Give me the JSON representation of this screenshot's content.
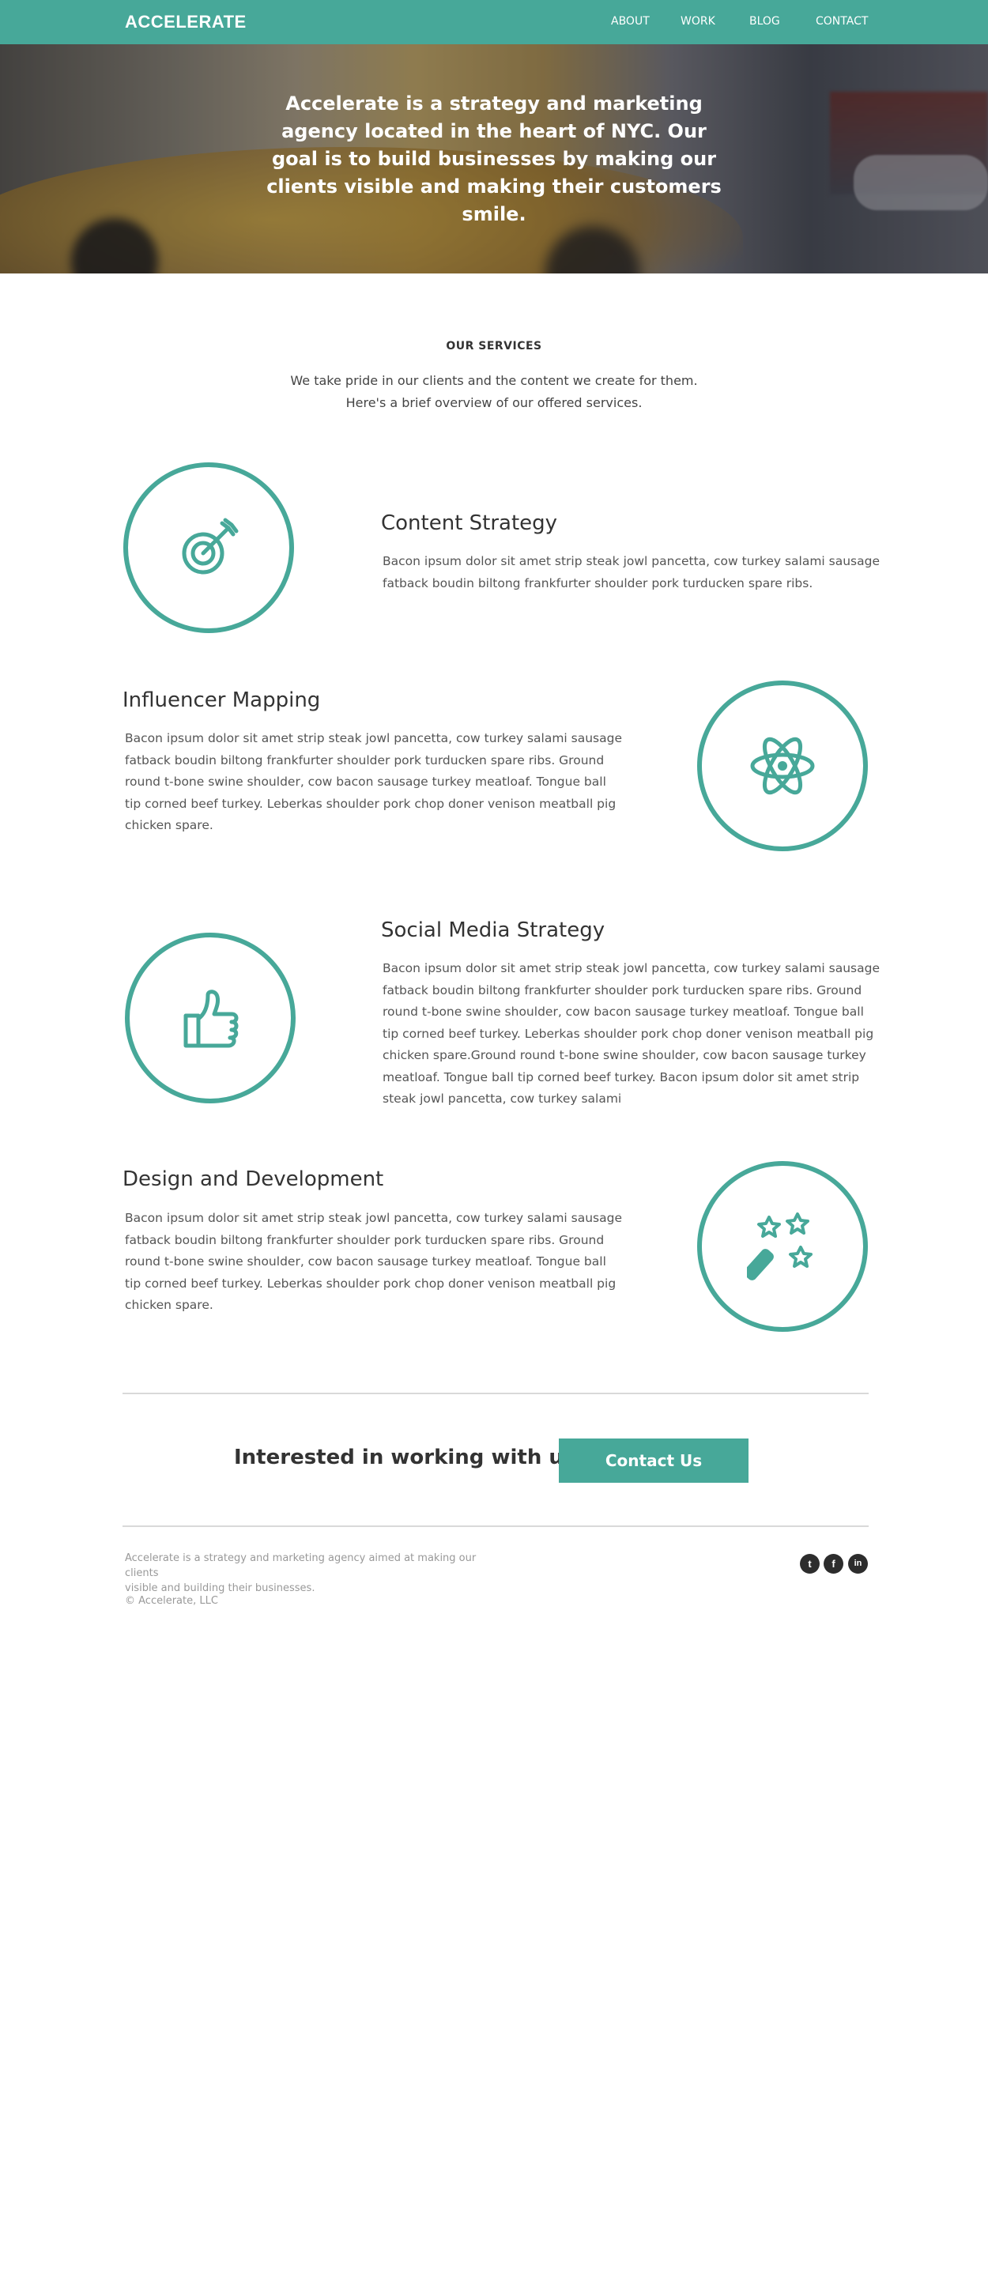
{
  "header": {
    "logo": "ACCELERATE",
    "nav": [
      "ABOUT",
      "WORK",
      "BLOG",
      "CONTACT"
    ]
  },
  "hero": {
    "text": "Accelerate is a strategy and marketing agency located in the heart of NYC. Our goal is to build businesses by making our clients visible and making their customers smile."
  },
  "services": {
    "title": "OUR SERVICES",
    "subtitle_lines": [
      "We take pride in our clients and the content we create for them.",
      "Here's a brief overview of our offered services."
    ],
    "items": [
      {
        "title": "Content Strategy",
        "icon": "target-icon",
        "lines": [
          "Bacon ipsum dolor sit amet strip steak jowl pancetta, cow turkey salami sausage",
          "fatback boudin biltong frankfurter shoulder pork turducken spare ribs."
        ]
      },
      {
        "title": "Influencer Mapping",
        "icon": "atom-icon",
        "lines": [
          "Bacon ipsum dolor sit amet strip steak jowl pancetta, cow turkey salami sausage",
          "fatback boudin biltong frankfurter shoulder pork turducken spare ribs. Ground",
          "round t-bone swine shoulder, cow bacon sausage turkey meatloaf. Tongue ball",
          "tip corned beef turkey. Leberkas shoulder pork chop doner venison meatball pig",
          "chicken spare."
        ]
      },
      {
        "title": "Social Media Strategy",
        "icon": "thumbs-up-icon",
        "lines": [
          "Bacon ipsum dolor sit amet strip steak jowl pancetta, cow turkey salami sausage",
          "fatback boudin biltong frankfurter shoulder pork turducken spare ribs. Ground",
          "round t-bone swine shoulder, cow bacon sausage turkey meatloaf. Tongue ball",
          "tip corned beef turkey. Leberkas shoulder pork chop doner venison meatball pig",
          "chicken spare.Ground round t-bone swine shoulder, cow bacon sausage turkey",
          "meatloaf. Tongue ball tip corned beef turkey. Bacon ipsum dolor sit amet strip",
          "steak jowl pancetta, cow turkey salami"
        ]
      },
      {
        "title": "Design and Development",
        "icon": "magic-wand-icon",
        "lines": [
          "Bacon ipsum dolor sit amet strip steak jowl pancetta, cow turkey salami sausage",
          "fatback boudin biltong frankfurter shoulder pork turducken spare ribs. Ground",
          "round t-bone swine shoulder, cow bacon sausage turkey meatloaf. Tongue ball",
          "tip corned beef turkey. Leberkas shoulder pork chop doner venison meatball pig",
          "chicken spare."
        ]
      }
    ]
  },
  "cta": {
    "text": "Interested in working with us?",
    "button": "Contact Us"
  },
  "footer": {
    "text_lines": [
      "Accelerate is a strategy and marketing agency aimed at making our clients",
      "visible and building their businesses."
    ],
    "copyright": "© Accelerate, LLC",
    "social": [
      {
        "icon": "twitter-icon",
        "glyph": "t"
      },
      {
        "icon": "facebook-icon",
        "glyph": "f"
      },
      {
        "icon": "linkedin-icon",
        "glyph": "in"
      }
    ]
  },
  "colors": {
    "accent": "#47a899",
    "text": "#333333",
    "muted": "#999999"
  }
}
